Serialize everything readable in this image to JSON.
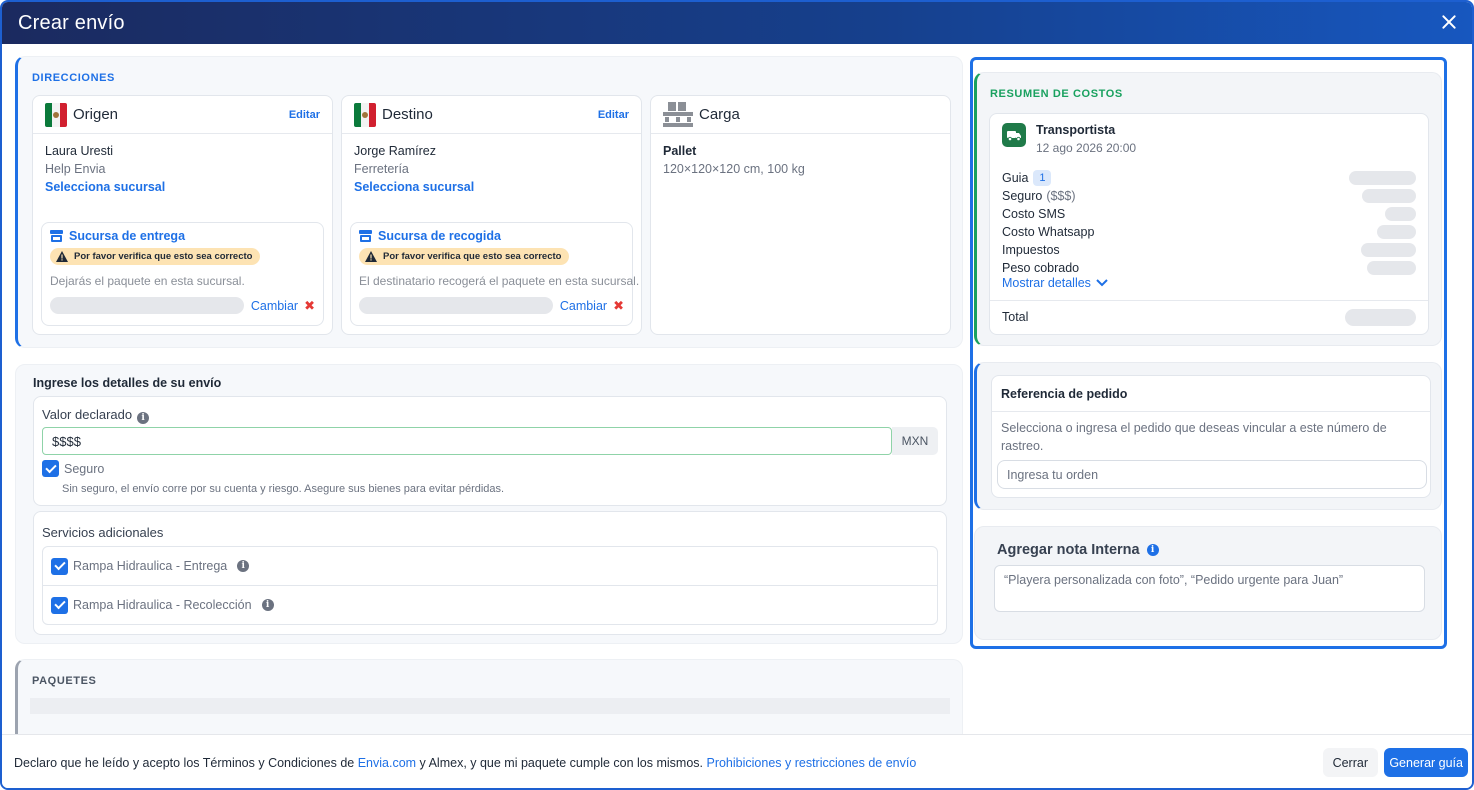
{
  "modal": {
    "title": "Crear envío"
  },
  "addresses": {
    "section_title": "DIRECCIONES",
    "edit_label": "Editar",
    "origin": {
      "title": "Origen",
      "name": "Laura Uresti",
      "company": "Help Envia",
      "select_branch": "Selecciona sucursal",
      "branch_title": "Sucursa de entrega",
      "warning": "Por favor verifica que esto sea correcto",
      "help": "Dejarás el paquete en esta sucursal.",
      "change": "Cambiar"
    },
    "destination": {
      "title": "Destino",
      "name": "Jorge Ramírez",
      "company": "Ferretería",
      "select_branch": "Selecciona sucursal",
      "branch_title": "Sucursa de recogida",
      "warning": "Por favor verifica que esto sea correcto",
      "help": "El destinatario recogerá el paquete en esta sucursal.",
      "change": "Cambiar"
    },
    "cargo": {
      "title": "Carga",
      "type": "Pallet",
      "dims": "120×120×120 cm, 100 kg"
    }
  },
  "details": {
    "title": "Ingrese los detalles de su envío",
    "declared_label": "Valor declarado",
    "declared_placeholder": "$$$$",
    "currency": "MXN",
    "insurance_label": "Seguro",
    "insurance_note": "Sin seguro, el envío corre por su cuenta y riesgo. Asegure sus bienes para evitar pérdidas.",
    "services_title": "Servicios adicionales",
    "services": [
      {
        "label": "Rampa Hidraulica - Entrega",
        "checked": true
      },
      {
        "label": "Rampa Hidraulica - Recolección",
        "checked": true
      }
    ]
  },
  "packages": {
    "title": "PAQUETES"
  },
  "summary": {
    "title": "RESUMEN DE COSTOS",
    "carrier": "Transportista",
    "date": "12 ago 2026 20:00",
    "rows": [
      {
        "label": "Guia",
        "badge": "1"
      },
      {
        "label": "Seguro",
        "suffix": "($$$)"
      },
      {
        "label": "Costo SMS"
      },
      {
        "label": "Costo Whatsapp"
      },
      {
        "label": "Impuestos"
      },
      {
        "label": "Peso cobrado"
      }
    ],
    "show_details": "Mostrar detalles",
    "total_label": "Total"
  },
  "order_ref": {
    "title": "Referencia de pedido",
    "description": "Selecciona o ingresa el pedido que deseas vincular a este número de rastreo.",
    "placeholder": "Ingresa tu orden"
  },
  "internal_note": {
    "title": "Agregar nota Interna",
    "placeholder": "“Playera personalizada con foto”, “Pedido urgente para Juan”"
  },
  "footer": {
    "text_before": "Declaro que he leído y acepto los Términos y Condiciones de ",
    "link_envia": "Envia.com",
    "text_middle": " y Almex, y que mi paquete cumple con los mismos. ",
    "link_prohibitions": "Prohibiciones y restricciones de envío",
    "close": "Cerrar",
    "generate": "Generar guía"
  },
  "colors": {
    "accent": "#1e70e6",
    "header_dark": "#1b2a5f",
    "success": "#19a15f",
    "warning_bg": "#fde3b3",
    "danger": "#e53935"
  },
  "icons": [
    "close-icon",
    "mexico-flag-icon",
    "pallet-icon",
    "store-icon",
    "warning-icon",
    "info-icon",
    "checkbox-checked-icon",
    "truck-icon",
    "chevron-down-icon"
  ]
}
